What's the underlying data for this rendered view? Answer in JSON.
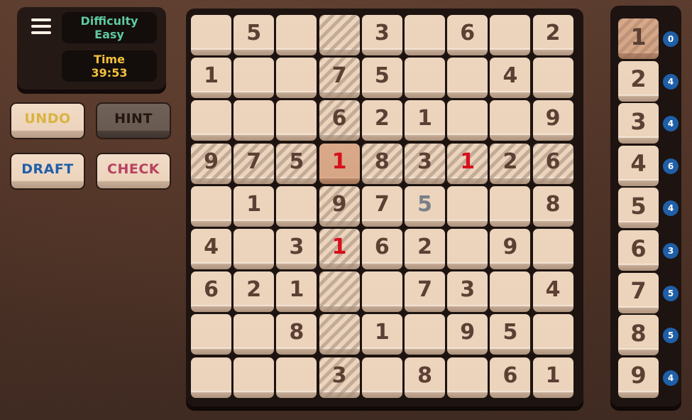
{
  "header": {
    "difficulty_label": "Difficulty",
    "difficulty_value": "Easy",
    "time_label": "Time",
    "time_value": "39:53"
  },
  "menu": {
    "icon": "hamburger-menu-icon"
  },
  "actions": {
    "undo": {
      "label": "UNDO",
      "color": "#d9b340"
    },
    "hint": {
      "label": "HINT",
      "color": "#22160f"
    },
    "draft": {
      "label": "DRAFT",
      "color": "#1f5fa8"
    },
    "check": {
      "label": "CHECK",
      "color": "#b8425f"
    }
  },
  "board": {
    "selected": {
      "row": 4,
      "col": 4,
      "value": "1"
    },
    "rows": [
      [
        "",
        "5",
        "",
        "",
        "3",
        "",
        "6",
        "",
        "2"
      ],
      [
        "1",
        "",
        "",
        "7",
        "5",
        "",
        "",
        "4",
        ""
      ],
      [
        "",
        "",
        "",
        "6",
        "2",
        "1",
        "",
        "",
        "9"
      ],
      [
        "9",
        "7",
        "5",
        "1",
        "8",
        "3",
        "1",
        "2",
        "6"
      ],
      [
        "",
        "1",
        "",
        "9",
        "7",
        "5",
        "",
        "",
        "8"
      ],
      [
        "4",
        "",
        "3",
        "1",
        "6",
        "2",
        "",
        "9",
        ""
      ],
      [
        "6",
        "2",
        "1",
        "",
        "",
        "7",
        "3",
        "",
        "4"
      ],
      [
        "",
        "",
        "8",
        "",
        "1",
        "",
        "9",
        "5",
        ""
      ],
      [
        "",
        "",
        "",
        "3",
        "",
        "8",
        "",
        "6",
        "1"
      ]
    ],
    "error_cells": [
      [
        4,
        4
      ],
      [
        4,
        7
      ],
      [
        6,
        4
      ]
    ],
    "user_cells": [
      [
        5,
        6
      ]
    ],
    "colors": {
      "given": "#5c4033",
      "error": "#d6101c",
      "user": "#7a7f86",
      "selected_bg": "#d6a586"
    }
  },
  "number_pad": [
    {
      "digit": "1",
      "remaining": "0"
    },
    {
      "digit": "2",
      "remaining": "4"
    },
    {
      "digit": "3",
      "remaining": "4"
    },
    {
      "digit": "4",
      "remaining": "6"
    },
    {
      "digit": "5",
      "remaining": "4"
    },
    {
      "digit": "6",
      "remaining": "3"
    },
    {
      "digit": "7",
      "remaining": "5"
    },
    {
      "digit": "8",
      "remaining": "5"
    },
    {
      "digit": "9",
      "remaining": "4"
    }
  ]
}
